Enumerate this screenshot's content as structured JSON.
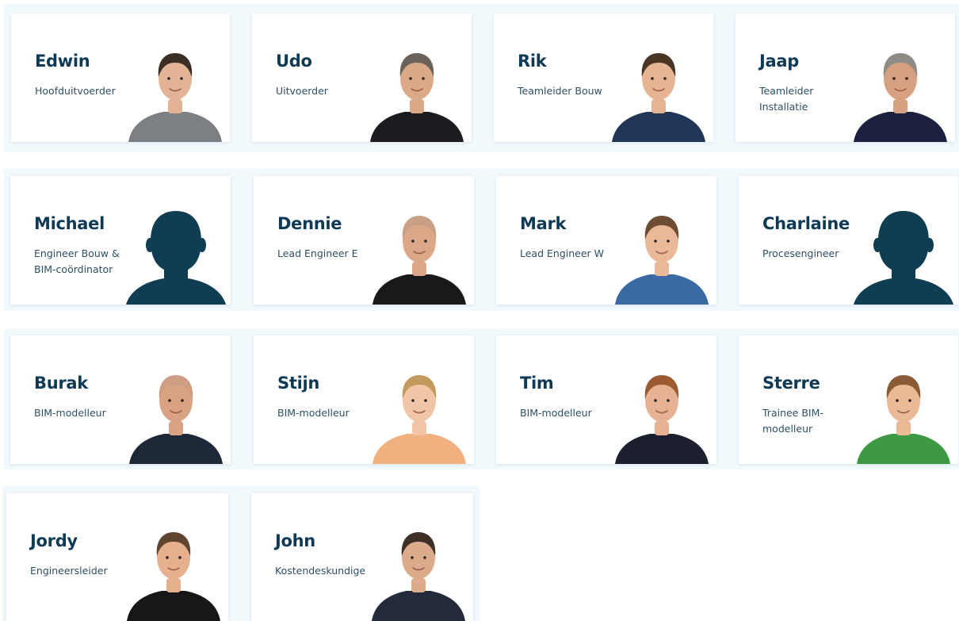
{
  "colors": {
    "band_background": "#f1f9fd",
    "card_background": "#ffffff",
    "name_text": "#0e3a55",
    "role_text": "#2c4f66",
    "silhouette": "#0f3d52"
  },
  "team": [
    {
      "id": "edwin",
      "name": "Edwin",
      "role": "Hoofduitvoerder",
      "photo": "portrait",
      "shirt": "#7c7f84",
      "hair": "#3a2e25",
      "skin": "#e3b395"
    },
    {
      "id": "udo",
      "name": "Udo",
      "role": "Uitvoerder",
      "photo": "portrait",
      "shirt": "#1c1c20",
      "hair": "#6a625b",
      "skin": "#dba988"
    },
    {
      "id": "rik",
      "name": "Rik",
      "role": "Teamleider Bouw",
      "photo": "portrait",
      "shirt": "#213656",
      "hair": "#4c3424",
      "skin": "#e6b493"
    },
    {
      "id": "jaap",
      "name": "Jaap",
      "role": "Teamleider Installatie",
      "photo": "portrait",
      "shirt": "#1c2140",
      "hair": "#8f8b86",
      "skin": "#d7a081"
    },
    {
      "id": "michael",
      "name": "Michael",
      "role": "Engineer Bouw & BIM-coördinator",
      "photo": "silhouette"
    },
    {
      "id": "dennie",
      "name": "Dennie",
      "role": "Lead Engineer E",
      "photo": "portrait",
      "shirt": "#19191c",
      "hair": "#c9a086",
      "skin": "#dca789"
    },
    {
      "id": "mark",
      "name": "Mark",
      "role": "Lead Engineer W",
      "photo": "portrait",
      "shirt": "#3a6aa4",
      "hair": "#6e4d33",
      "skin": "#eab999"
    },
    {
      "id": "charlaine",
      "name": "Charlaine",
      "role": "Procesengineer",
      "photo": "silhouette"
    },
    {
      "id": "burak",
      "name": "Burak",
      "role": "BIM-modelleur",
      "photo": "portrait",
      "shirt": "#1e2738",
      "hair": "#cf9e82",
      "skin": "#d8a283"
    },
    {
      "id": "stijn",
      "name": "Stijn",
      "role": "BIM-modelleur",
      "photo": "portrait",
      "shirt": "#f0b07f",
      "hair": "#c39a5d",
      "skin": "#f0c6a7"
    },
    {
      "id": "tim",
      "name": "Tim",
      "role": "BIM-modelleur",
      "photo": "portrait",
      "shirt": "#1c1f2d",
      "hair": "#9b5a2f",
      "skin": "#e7b193"
    },
    {
      "id": "sterre",
      "name": "Sterre",
      "role": "Trainee BIM-modelleur",
      "photo": "portrait",
      "shirt": "#3d9a42",
      "hair": "#8a5b35",
      "skin": "#eab996"
    },
    {
      "id": "jordy",
      "name": "Jordy",
      "role": "Engineersleider",
      "photo": "portrait",
      "shirt": "#17171a",
      "hair": "#5f4530",
      "skin": "#e6b08f"
    },
    {
      "id": "john",
      "name": "John",
      "role": "Kostendeskundige",
      "photo": "portrait",
      "shirt": "#222a3b",
      "hair": "#3e3027",
      "skin": "#dcab8c"
    }
  ]
}
